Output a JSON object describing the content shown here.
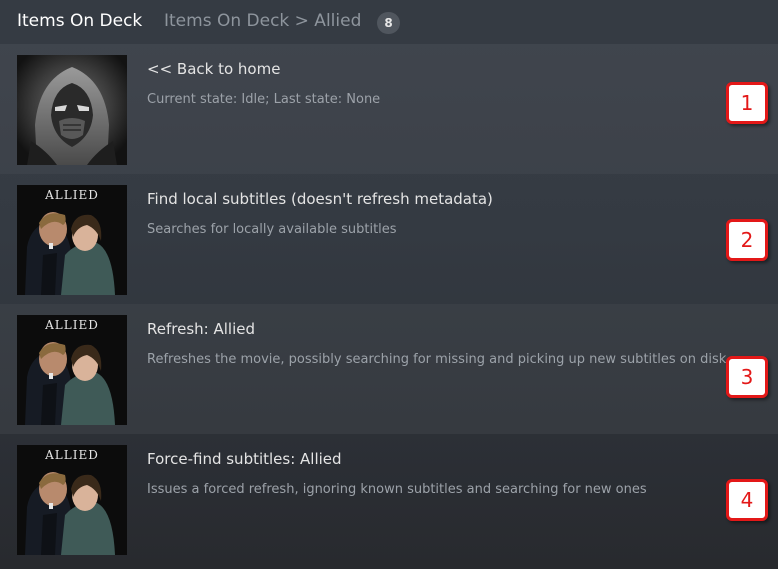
{
  "header": {
    "title": "Items On Deck",
    "breadcrumb": "Items On Deck > Allied",
    "count": "8"
  },
  "rows": [
    {
      "title": "<< Back to home",
      "description": "Current state: Idle; Last state: None",
      "thumbnail": "masked-warrior",
      "badge": "1"
    },
    {
      "title": "Find local subtitles (doesn't refresh metadata)",
      "description": "Searches for locally available subtitles",
      "thumbnail": "allied-poster",
      "poster_text": "ALLIED",
      "badge": "2"
    },
    {
      "title": "Refresh: Allied",
      "description": "Refreshes the movie, possibly searching for missing and picking up new subtitles on disk",
      "thumbnail": "allied-poster",
      "poster_text": "ALLIED",
      "badge": "3"
    },
    {
      "title": "Force-find subtitles: Allied",
      "description": "Issues a forced refresh, ignoring known subtitles and searching for new ones",
      "thumbnail": "allied-poster",
      "poster_text": "ALLIED",
      "badge": "4"
    }
  ],
  "colors": {
    "badge_red": "#e31818",
    "background": "#343a42"
  }
}
